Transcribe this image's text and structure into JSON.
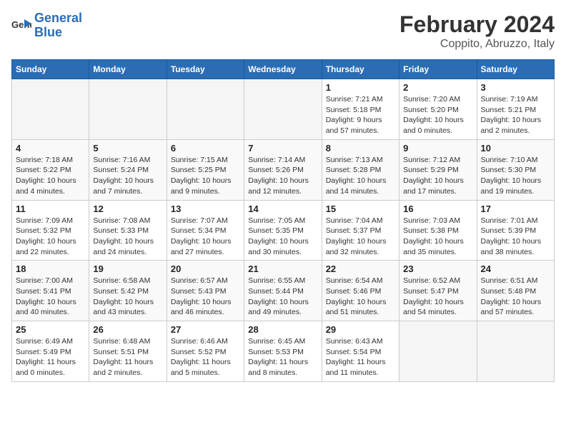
{
  "header": {
    "logo_line1": "General",
    "logo_line2": "Blue",
    "title": "February 2024",
    "subtitle": "Coppito, Abruzzo, Italy"
  },
  "weekdays": [
    "Sunday",
    "Monday",
    "Tuesday",
    "Wednesday",
    "Thursday",
    "Friday",
    "Saturday"
  ],
  "weeks": [
    [
      {
        "day": "",
        "info": ""
      },
      {
        "day": "",
        "info": ""
      },
      {
        "day": "",
        "info": ""
      },
      {
        "day": "",
        "info": ""
      },
      {
        "day": "1",
        "info": "Sunrise: 7:21 AM\nSunset: 5:18 PM\nDaylight: 9 hours and 57 minutes."
      },
      {
        "day": "2",
        "info": "Sunrise: 7:20 AM\nSunset: 5:20 PM\nDaylight: 10 hours and 0 minutes."
      },
      {
        "day": "3",
        "info": "Sunrise: 7:19 AM\nSunset: 5:21 PM\nDaylight: 10 hours and 2 minutes."
      }
    ],
    [
      {
        "day": "4",
        "info": "Sunrise: 7:18 AM\nSunset: 5:22 PM\nDaylight: 10 hours and 4 minutes."
      },
      {
        "day": "5",
        "info": "Sunrise: 7:16 AM\nSunset: 5:24 PM\nDaylight: 10 hours and 7 minutes."
      },
      {
        "day": "6",
        "info": "Sunrise: 7:15 AM\nSunset: 5:25 PM\nDaylight: 10 hours and 9 minutes."
      },
      {
        "day": "7",
        "info": "Sunrise: 7:14 AM\nSunset: 5:26 PM\nDaylight: 10 hours and 12 minutes."
      },
      {
        "day": "8",
        "info": "Sunrise: 7:13 AM\nSunset: 5:28 PM\nDaylight: 10 hours and 14 minutes."
      },
      {
        "day": "9",
        "info": "Sunrise: 7:12 AM\nSunset: 5:29 PM\nDaylight: 10 hours and 17 minutes."
      },
      {
        "day": "10",
        "info": "Sunrise: 7:10 AM\nSunset: 5:30 PM\nDaylight: 10 hours and 19 minutes."
      }
    ],
    [
      {
        "day": "11",
        "info": "Sunrise: 7:09 AM\nSunset: 5:32 PM\nDaylight: 10 hours and 22 minutes."
      },
      {
        "day": "12",
        "info": "Sunrise: 7:08 AM\nSunset: 5:33 PM\nDaylight: 10 hours and 24 minutes."
      },
      {
        "day": "13",
        "info": "Sunrise: 7:07 AM\nSunset: 5:34 PM\nDaylight: 10 hours and 27 minutes."
      },
      {
        "day": "14",
        "info": "Sunrise: 7:05 AM\nSunset: 5:35 PM\nDaylight: 10 hours and 30 minutes."
      },
      {
        "day": "15",
        "info": "Sunrise: 7:04 AM\nSunset: 5:37 PM\nDaylight: 10 hours and 32 minutes."
      },
      {
        "day": "16",
        "info": "Sunrise: 7:03 AM\nSunset: 5:38 PM\nDaylight: 10 hours and 35 minutes."
      },
      {
        "day": "17",
        "info": "Sunrise: 7:01 AM\nSunset: 5:39 PM\nDaylight: 10 hours and 38 minutes."
      }
    ],
    [
      {
        "day": "18",
        "info": "Sunrise: 7:00 AM\nSunset: 5:41 PM\nDaylight: 10 hours and 40 minutes."
      },
      {
        "day": "19",
        "info": "Sunrise: 6:58 AM\nSunset: 5:42 PM\nDaylight: 10 hours and 43 minutes."
      },
      {
        "day": "20",
        "info": "Sunrise: 6:57 AM\nSunset: 5:43 PM\nDaylight: 10 hours and 46 minutes."
      },
      {
        "day": "21",
        "info": "Sunrise: 6:55 AM\nSunset: 5:44 PM\nDaylight: 10 hours and 49 minutes."
      },
      {
        "day": "22",
        "info": "Sunrise: 6:54 AM\nSunset: 5:46 PM\nDaylight: 10 hours and 51 minutes."
      },
      {
        "day": "23",
        "info": "Sunrise: 6:52 AM\nSunset: 5:47 PM\nDaylight: 10 hours and 54 minutes."
      },
      {
        "day": "24",
        "info": "Sunrise: 6:51 AM\nSunset: 5:48 PM\nDaylight: 10 hours and 57 minutes."
      }
    ],
    [
      {
        "day": "25",
        "info": "Sunrise: 6:49 AM\nSunset: 5:49 PM\nDaylight: 11 hours and 0 minutes."
      },
      {
        "day": "26",
        "info": "Sunrise: 6:48 AM\nSunset: 5:51 PM\nDaylight: 11 hours and 2 minutes."
      },
      {
        "day": "27",
        "info": "Sunrise: 6:46 AM\nSunset: 5:52 PM\nDaylight: 11 hours and 5 minutes."
      },
      {
        "day": "28",
        "info": "Sunrise: 6:45 AM\nSunset: 5:53 PM\nDaylight: 11 hours and 8 minutes."
      },
      {
        "day": "29",
        "info": "Sunrise: 6:43 AM\nSunset: 5:54 PM\nDaylight: 11 hours and 11 minutes."
      },
      {
        "day": "",
        "info": ""
      },
      {
        "day": "",
        "info": ""
      }
    ]
  ]
}
